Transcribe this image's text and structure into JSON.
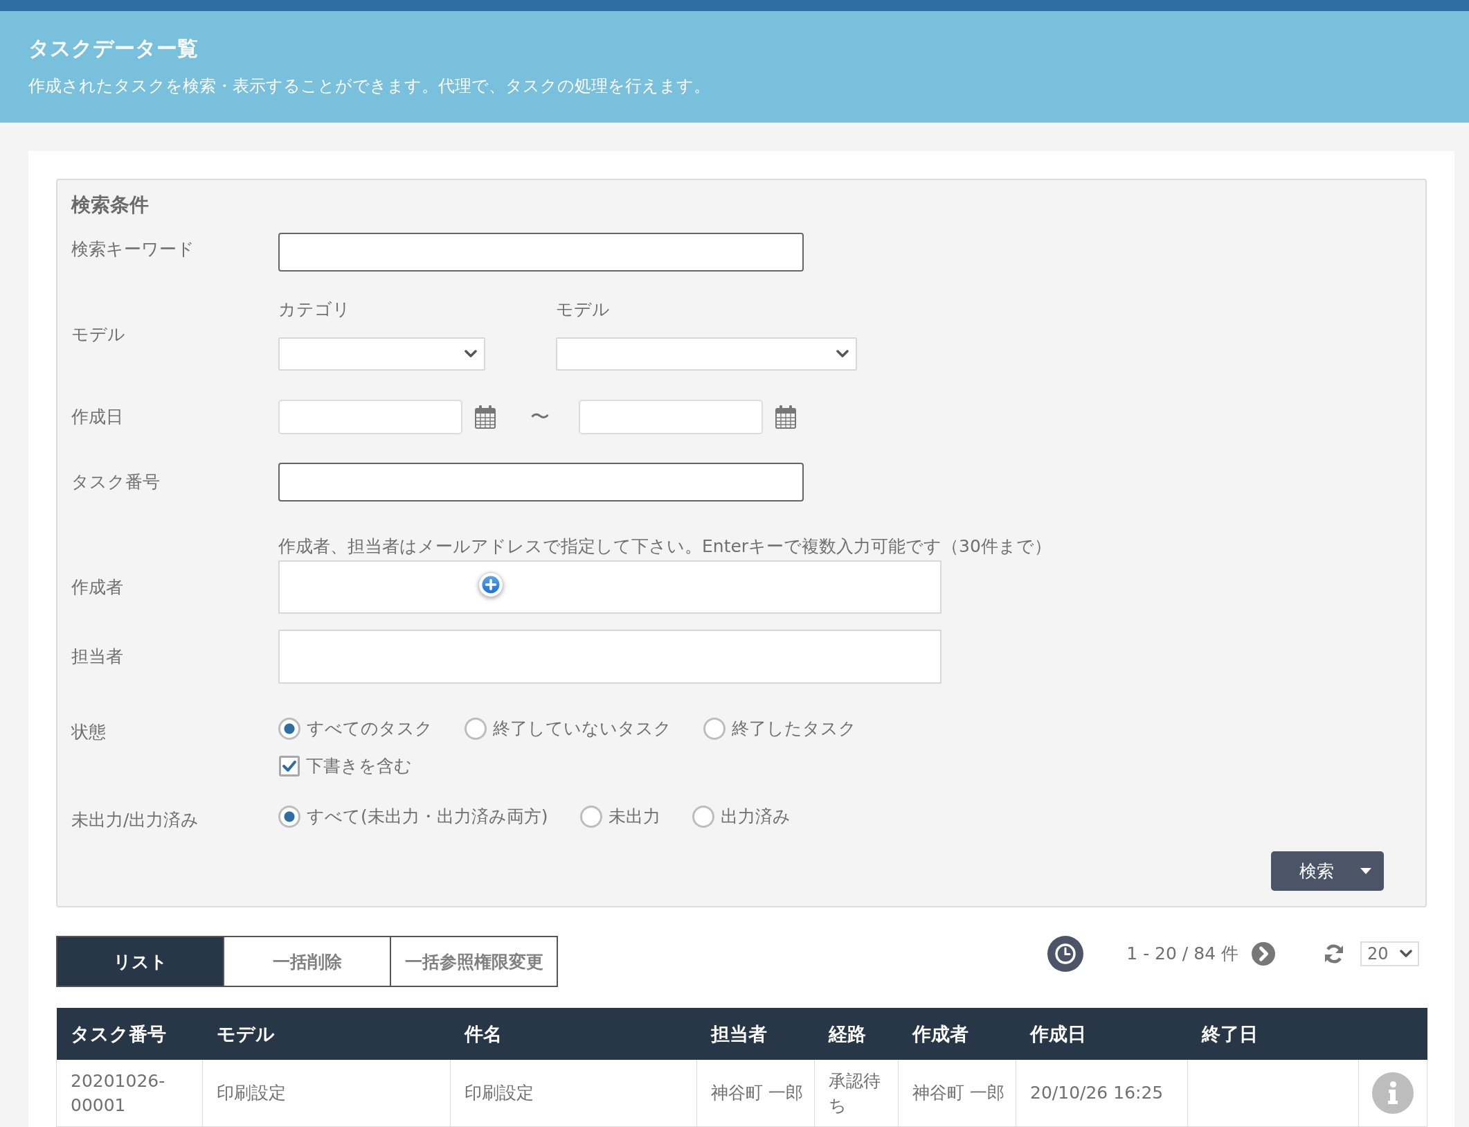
{
  "header": {
    "title": "タスクデーター覧",
    "description": "作成されたタスクを検索・表示することができます。代理で、タスクの処理を行えます。"
  },
  "search_panel": {
    "heading": "検索条件",
    "keyword": {
      "label": "検索キーワード"
    },
    "model": {
      "label": "モデル",
      "category_label": "カテゴリ",
      "model_label": "モデル"
    },
    "created_date": {
      "label": "作成日",
      "separator": "〜"
    },
    "task_number": {
      "label": "タスク番号"
    },
    "address_note": "作成者、担当者はメールアドレスで指定して下さい。Enterキーで複数入力可能です（30件まで）",
    "creator": {
      "label": "作成者"
    },
    "assignee": {
      "label": "担当者"
    },
    "status": {
      "label": "状態",
      "options": [
        {
          "label": "すべてのタスク",
          "selected": true
        },
        {
          "label": "終了していないタスク",
          "selected": false
        },
        {
          "label": "終了したタスク",
          "selected": false
        }
      ],
      "include_drafts": {
        "label": "下書きを含む",
        "checked": true
      }
    },
    "output_state": {
      "label": "未出力/出力済み",
      "options": [
        {
          "label": "すべて(未出力・出力済み両方)",
          "selected": true
        },
        {
          "label": "未出力",
          "selected": false
        },
        {
          "label": "出力済み",
          "selected": false
        }
      ]
    },
    "search_button": "検索"
  },
  "tabs": [
    {
      "label": "リスト",
      "selected": true
    },
    {
      "label": "一括削除",
      "selected": false
    },
    {
      "label": "一括参照権限変更",
      "selected": false
    }
  ],
  "pagination": {
    "range": "1 - 20 / 84 件",
    "page_size": "20"
  },
  "table": {
    "columns": [
      "タスク番号",
      "モデル",
      "件名",
      "担当者",
      "経路",
      "作成者",
      "作成日",
      "終了日"
    ],
    "rows": [
      {
        "cells": [
          "20201026-00001",
          "印刷設定",
          "印刷設定",
          "神谷町 一郎",
          "承認待ち",
          "神谷町 一郎",
          "20/10/26 16:25"
        ]
      }
    ]
  }
}
